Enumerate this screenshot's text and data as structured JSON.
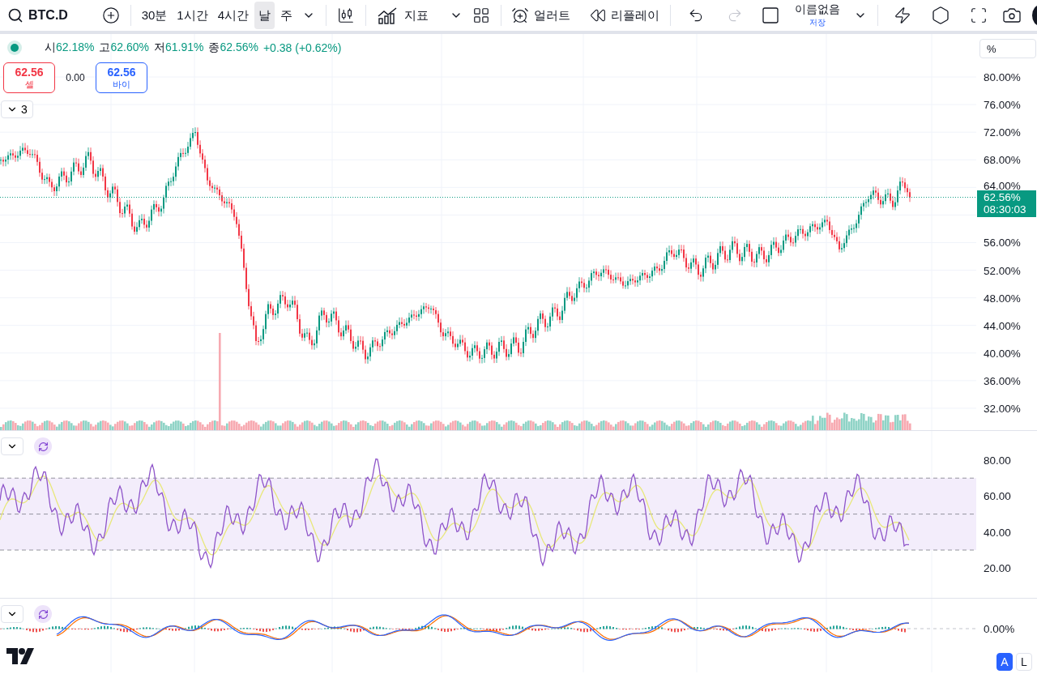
{
  "toolbar": {
    "symbol": "BTC.D",
    "timeframes": [
      {
        "label": "30분",
        "selected": false
      },
      {
        "label": "1시간",
        "selected": false
      },
      {
        "label": "4시간",
        "selected": false
      },
      {
        "label": "날",
        "selected": true
      },
      {
        "label": "주",
        "selected": false
      }
    ],
    "indicators_label": "지표",
    "alert_label": "얼러트",
    "replay_label": "리플레이",
    "history": [
      {
        "kind": "undo",
        "disabled": false
      },
      {
        "kind": "redo",
        "disabled": true
      }
    ],
    "layout": {
      "name": "이름없음",
      "status": "저장"
    }
  },
  "legend": {
    "fields": [
      {
        "label": "시",
        "value": "62.18%"
      },
      {
        "label": "고",
        "value": "62.60%"
      },
      {
        "label": "저",
        "value": "61.91%"
      },
      {
        "label": "종",
        "value": "62.56%"
      }
    ],
    "change": "+0.38 (+0.62%)"
  },
  "trade": {
    "sell": {
      "price": "62.56",
      "label": "셀"
    },
    "spread": "0.00",
    "buy": {
      "price": "62.56",
      "label": "바이"
    }
  },
  "collapse_count": "3",
  "price_scale": {
    "unit": "%",
    "ticks_upper": [
      "80.00%",
      "76.00%",
      "72.00%",
      "68.00%",
      "64.00%"
    ],
    "ticks_lower": [
      "56.00%",
      "52.00%",
      "48.00%",
      "44.00%",
      "40.00%",
      "36.00%",
      "32.00%"
    ],
    "last_price": "62.56%",
    "countdown": "08:30:03"
  },
  "rsi_pane": {
    "ticks": [
      "80.00",
      "60.00",
      "40.00",
      "20.00"
    ]
  },
  "macd_pane": {
    "ticks": [
      "0.00%"
    ]
  },
  "scale_modes": [
    {
      "label": "A",
      "selected": true
    },
    {
      "label": "L",
      "selected": false
    }
  ]
}
